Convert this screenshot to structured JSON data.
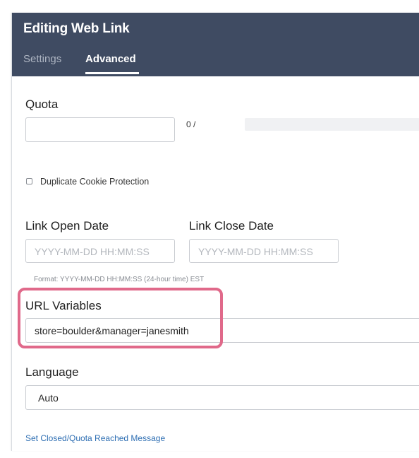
{
  "header": {
    "title": "Editing Web Link",
    "tabs": [
      {
        "label": "Settings"
      },
      {
        "label": "Advanced"
      }
    ]
  },
  "quota": {
    "label": "Quota",
    "value": "",
    "count_text": "0 /",
    "progress_fraction": 0.0
  },
  "duplicate_cookie": {
    "label": "Duplicate Cookie Protection",
    "checked": false
  },
  "dates": {
    "open_label": "Link Open Date",
    "open_placeholder": "YYYY-MM-DD HH:MM:SS",
    "close_label": "Link Close Date",
    "close_placeholder": "YYYY-MM-DD HH:MM:SS",
    "format_hint": "Format: YYYY-MM-DD HH:MM:SS (24-hour time) EST"
  },
  "url_variables": {
    "label": "URL Variables",
    "value": "store=boulder&manager=janesmith"
  },
  "language": {
    "label": "Language",
    "selected": "Auto"
  },
  "closed_message_link": "Set Closed/Quota Reached Message",
  "colors": {
    "header_bg": "#3f4b62",
    "highlight_border": "#e0698a",
    "link": "#2f6fb3"
  }
}
